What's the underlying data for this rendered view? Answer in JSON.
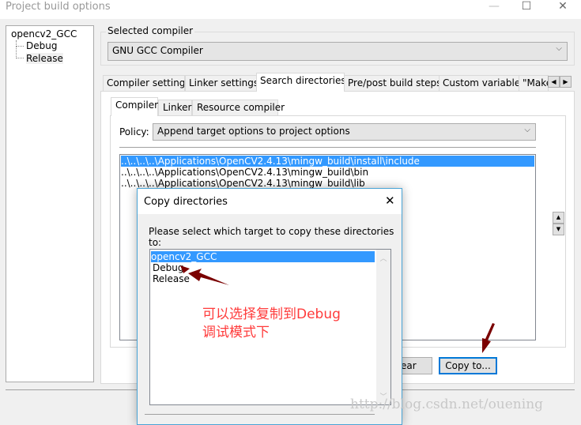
{
  "window": {
    "title": "Project build options",
    "minimize": "—",
    "maximize": "☐",
    "close": "✕"
  },
  "tree": {
    "root": "opencv2_GCC",
    "children": [
      "Debug",
      "Release"
    ]
  },
  "compiler_group": {
    "label": "Selected compiler",
    "value": "GNU GCC Compiler"
  },
  "tabs": [
    "Compiler settings",
    "Linker settings",
    "Search directories",
    "Pre/post build steps",
    "Custom variables",
    "\"Make\" commands"
  ],
  "active_tab": "Search directories",
  "inner_tabs": [
    "Compiler",
    "Linker",
    "Resource compiler"
  ],
  "policy": {
    "label": "Policy:",
    "value": "Append target options to project options"
  },
  "directories": [
    "..\\..\\..\\..\\Applications\\OpenCV2.4.13\\mingw_build\\install\\include",
    "..\\..\\..\\..\\Applications\\OpenCV2.4.13\\mingw_build\\bin",
    "..\\..\\..\\..\\Applications\\OpenCV2.4.13\\mingw_build\\lib"
  ],
  "buttons": {
    "clear": "Clear",
    "copy_to": "Copy to..."
  },
  "dialog": {
    "title": "Copy directories",
    "prompt": "Please select which target to copy these directories to:",
    "targets": [
      "opencv2_GCC",
      "Debug",
      "Release"
    ],
    "close": "✕"
  },
  "annotation": {
    "line1": "可以选择复制到Debug",
    "line2": "调试模式下",
    "color": "#ff3b3b",
    "arrow_color": "#7a0000"
  },
  "watermark": "http://blog.csdn.net/ouening"
}
